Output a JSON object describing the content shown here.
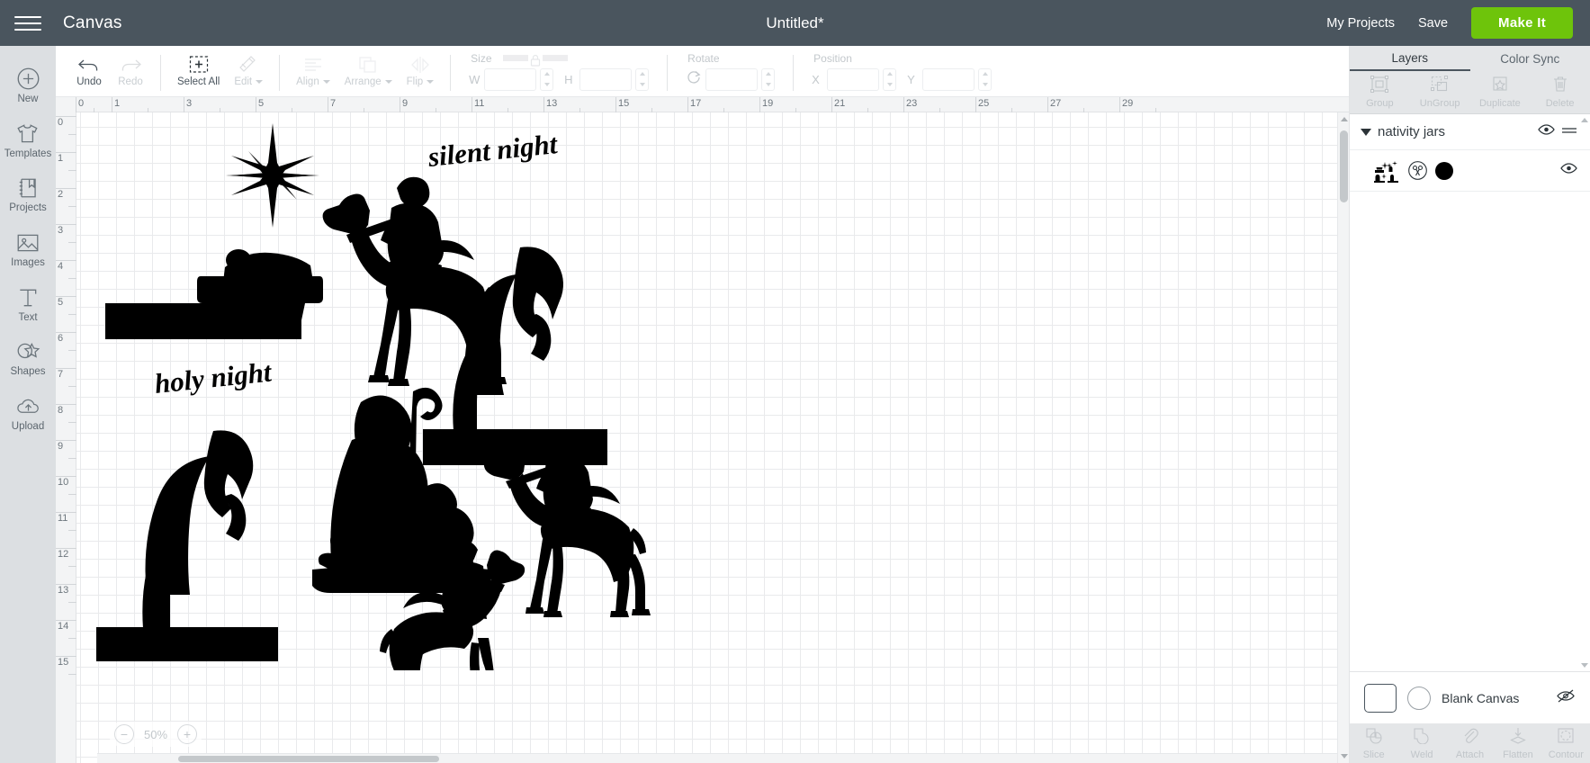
{
  "topbar": {
    "menu_icon": "hamburger-icon",
    "app_title": "Canvas",
    "document_title": "Untitled*",
    "my_projects": "My Projects",
    "save": "Save",
    "make_it": "Make It",
    "bg_color": "#4a555e",
    "make_it_color": "#6ec40b"
  },
  "rail": {
    "items": [
      {
        "label": "New",
        "icon": "plus-circle-icon"
      },
      {
        "label": "Templates",
        "icon": "tshirt-icon"
      },
      {
        "label": "Projects",
        "icon": "book-bookmark-icon"
      },
      {
        "label": "Images",
        "icon": "picture-icon"
      },
      {
        "label": "Text",
        "icon": "text-t-icon"
      },
      {
        "label": "Shapes",
        "icon": "shapes-icon"
      },
      {
        "label": "Upload",
        "icon": "cloud-upload-icon"
      }
    ]
  },
  "toolbar": {
    "undo": "Undo",
    "redo": "Redo",
    "select_all": "Select All",
    "edit": "Edit",
    "align": "Align",
    "arrange": "Arrange",
    "flip": "Flip",
    "size_title": "Size",
    "size_w_label": "W",
    "size_h_label": "H",
    "size_w_value": "",
    "size_h_value": "",
    "rotate_title": "Rotate",
    "rotate_value": "",
    "position_title": "Position",
    "position_x_label": "X",
    "position_y_label": "Y",
    "position_x_value": "",
    "position_y_value": ""
  },
  "canvas": {
    "zoom_value": "50%",
    "zoom_out": "−",
    "zoom_in": "+",
    "ruler_top_numbers": [
      "0",
      "1",
      "3",
      "5",
      "7",
      "9",
      "11",
      "13",
      "15",
      "17",
      "19",
      "21",
      "23",
      "25",
      "27",
      "29"
    ],
    "ruler_left_numbers": [
      "0",
      "1",
      "2",
      "3",
      "4",
      "5",
      "6",
      "7",
      "8",
      "9",
      "10",
      "11",
      "12",
      "13",
      "14",
      "15"
    ],
    "artwork": {
      "silent_night_text": "silent night",
      "holy_night_text": "holy night"
    }
  },
  "right_panel": {
    "tabs": [
      {
        "label": "Layers",
        "active": true
      },
      {
        "label": "Color Sync",
        "active": false
      }
    ],
    "tools": [
      {
        "label": "Group",
        "icon": "group-icon"
      },
      {
        "label": "UnGroup",
        "icon": "ungroup-icon"
      },
      {
        "label": "Duplicate",
        "icon": "duplicate-icon"
      },
      {
        "label": "Delete",
        "icon": "trash-icon"
      }
    ],
    "group": {
      "name": "nativity jars",
      "visibility_icon": "eye-icon",
      "menu_icon": "hamburger-small-icon"
    },
    "layer": {
      "thumbnail": "nativity-silhouette-thumb",
      "operation_icon": "scissors-cut-icon",
      "color": "#000000",
      "visibility_icon": "eye-icon"
    },
    "blank_canvas": {
      "label": "Blank Canvas",
      "swatch_color": "#ffffff",
      "visibility_icon": "eye-off-icon"
    },
    "bottom_ops": [
      {
        "label": "Slice",
        "icon": "slice-icon"
      },
      {
        "label": "Weld",
        "icon": "weld-icon"
      },
      {
        "label": "Attach",
        "icon": "paperclip-icon"
      },
      {
        "label": "Flatten",
        "icon": "flatten-icon"
      },
      {
        "label": "Contour",
        "icon": "contour-icon"
      }
    ]
  }
}
